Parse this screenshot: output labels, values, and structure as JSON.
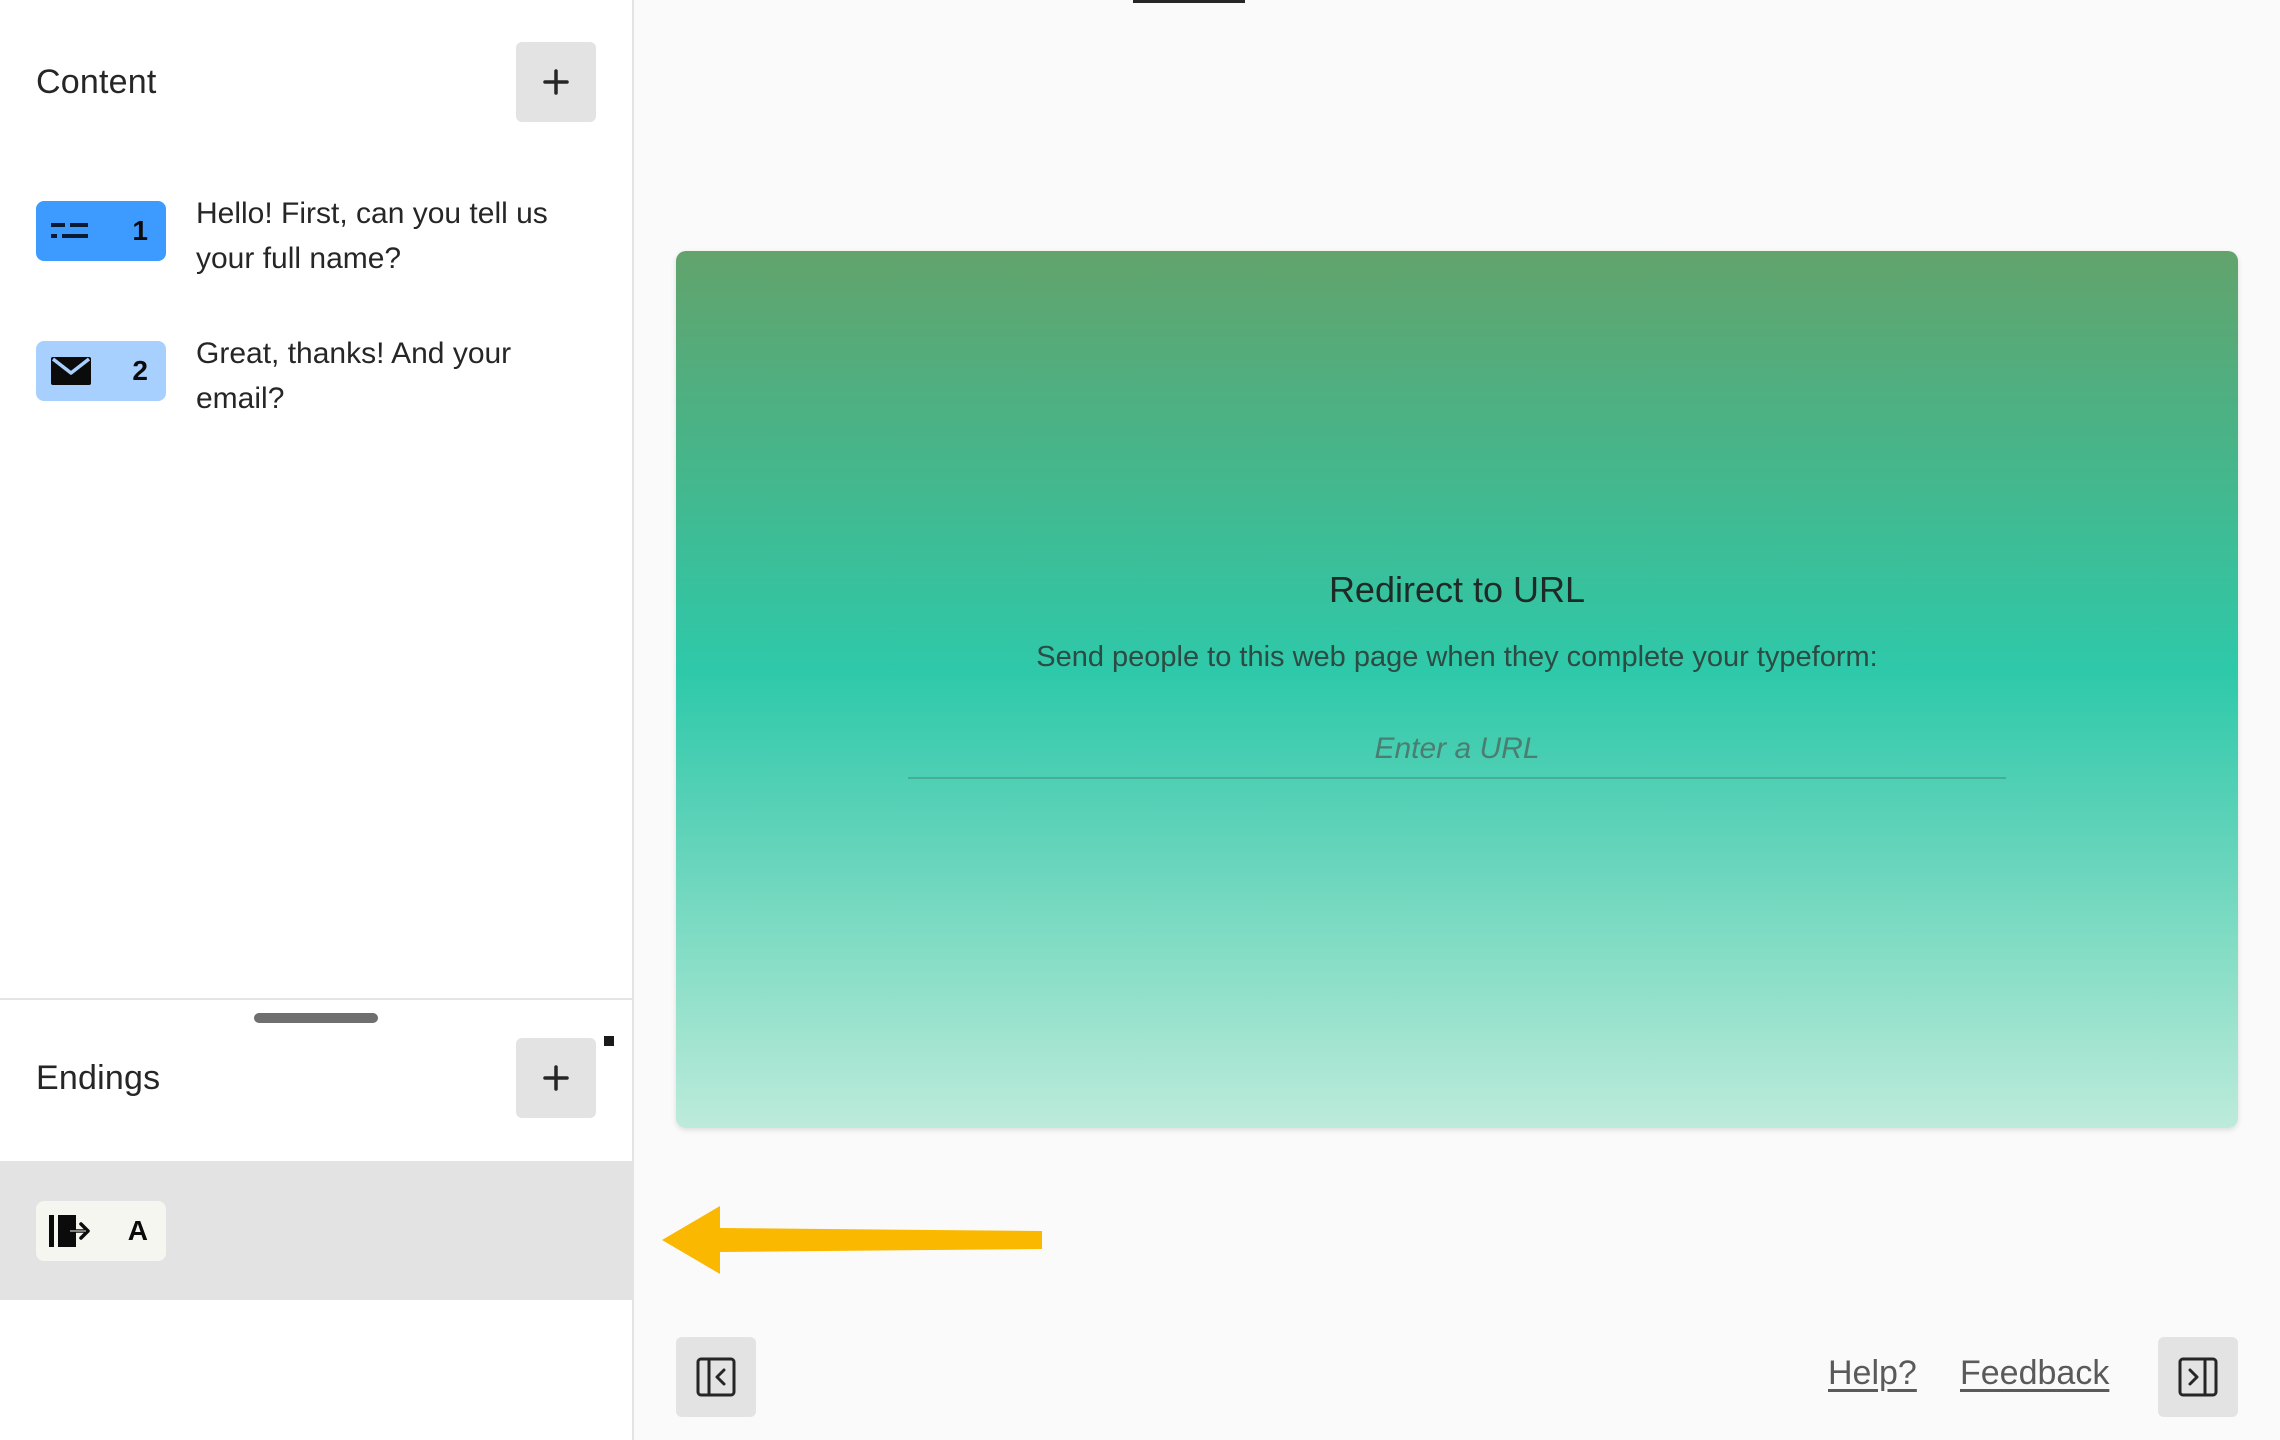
{
  "sidebar": {
    "content_title": "Content",
    "questions": [
      {
        "number": "1",
        "text": "Hello! First, can you tell us your full name?",
        "icon": "short-text-icon",
        "color": "#3d9bff"
      },
      {
        "number": "2",
        "text": "Great, thanks! And your email?",
        "icon": "email-icon",
        "color": "#a8d0ff"
      }
    ],
    "endings_title": "Endings",
    "endings": [
      {
        "label": "A",
        "icon": "redirect-exit-icon",
        "color": "#f6f6f1"
      }
    ]
  },
  "card": {
    "title": "Redirect to URL",
    "subtitle": "Send people to this web page when they complete your typeform:",
    "url_placeholder": "Enter a URL",
    "url_value": ""
  },
  "footer": {
    "help_label": "Help?",
    "feedback_label": "Feedback"
  },
  "colors": {
    "annotation_arrow": "#fbb800",
    "card_gradient_top": "#62a36c",
    "card_gradient_mid": "#2ec9aa",
    "card_gradient_bottom": "#bdebdb"
  }
}
